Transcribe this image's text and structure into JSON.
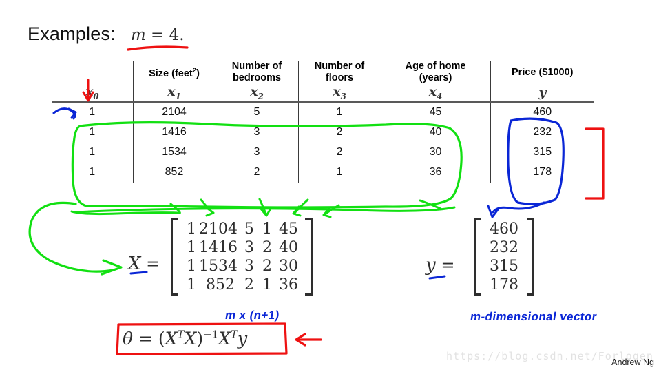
{
  "slide": {
    "title": "Examples:",
    "title_math": "m = 4."
  },
  "table": {
    "columns": [
      {
        "label": "",
        "symbol": "x0",
        "symbol_base": "x",
        "symbol_sub": "0"
      },
      {
        "label": "Size (feet2)",
        "label_main": "Size (feet",
        "label_sup": "2",
        "label_tail": ")",
        "symbol_base": "x",
        "symbol_sub": "1"
      },
      {
        "label": "Number of bedrooms",
        "line1": "Number of",
        "line2": "bedrooms",
        "symbol_base": "x",
        "symbol_sub": "2"
      },
      {
        "label": "Number of floors",
        "line1": "Number of",
        "line2": "floors",
        "symbol_base": "x",
        "symbol_sub": "3"
      },
      {
        "label": "Age of home (years)",
        "line1": "Age of home",
        "line2": "(years)",
        "symbol_base": "x",
        "symbol_sub": "4"
      },
      {
        "label": "Price ($1000)",
        "line1": "Price ($1000)",
        "line2": "",
        "symbol_base": "y",
        "symbol_sub": ""
      }
    ],
    "rows": [
      [
        "1",
        "2104",
        "5",
        "1",
        "45",
        "460"
      ],
      [
        "1",
        "1416",
        "3",
        "2",
        "40",
        "232"
      ],
      [
        "1",
        "1534",
        "3",
        "2",
        "30",
        "315"
      ],
      [
        "1",
        "852",
        "2",
        "1",
        "36",
        "178"
      ]
    ]
  },
  "matrices": {
    "X_label": "X =",
    "X_rows": [
      [
        "1",
        "2104",
        "5",
        "1",
        "45"
      ],
      [
        "1",
        "1416",
        "3",
        "2",
        "40"
      ],
      [
        "1",
        "1534",
        "3",
        "2",
        "30"
      ],
      [
        "1",
        "852",
        "2",
        "1",
        "36"
      ]
    ],
    "y_label": "y =",
    "y_rows": [
      "460",
      "232",
      "315",
      "178"
    ]
  },
  "annotations": {
    "dim_X": "m x (n+1)",
    "dim_y": "m-dimensional  vector",
    "normal_equation": "θ = (X T X) −1 X T y",
    "normal_equation_parts": {
      "theta": "θ",
      "eq": "=",
      "open": "(",
      "X1": "X",
      "T1": "T",
      "X2": "X",
      "close": ")",
      "inv": "−1",
      "X3": "X",
      "T2": "T",
      "y": "y"
    }
  },
  "colors": {
    "red": "#ee1111",
    "green": "#12e012",
    "blue": "#0a26d6",
    "rule": "#595959",
    "text": "#111111",
    "watermark": "#e2e2e2"
  },
  "footer": {
    "watermark": "https://blog.csdn.net/Forlogen",
    "author": "Andrew Ng"
  }
}
